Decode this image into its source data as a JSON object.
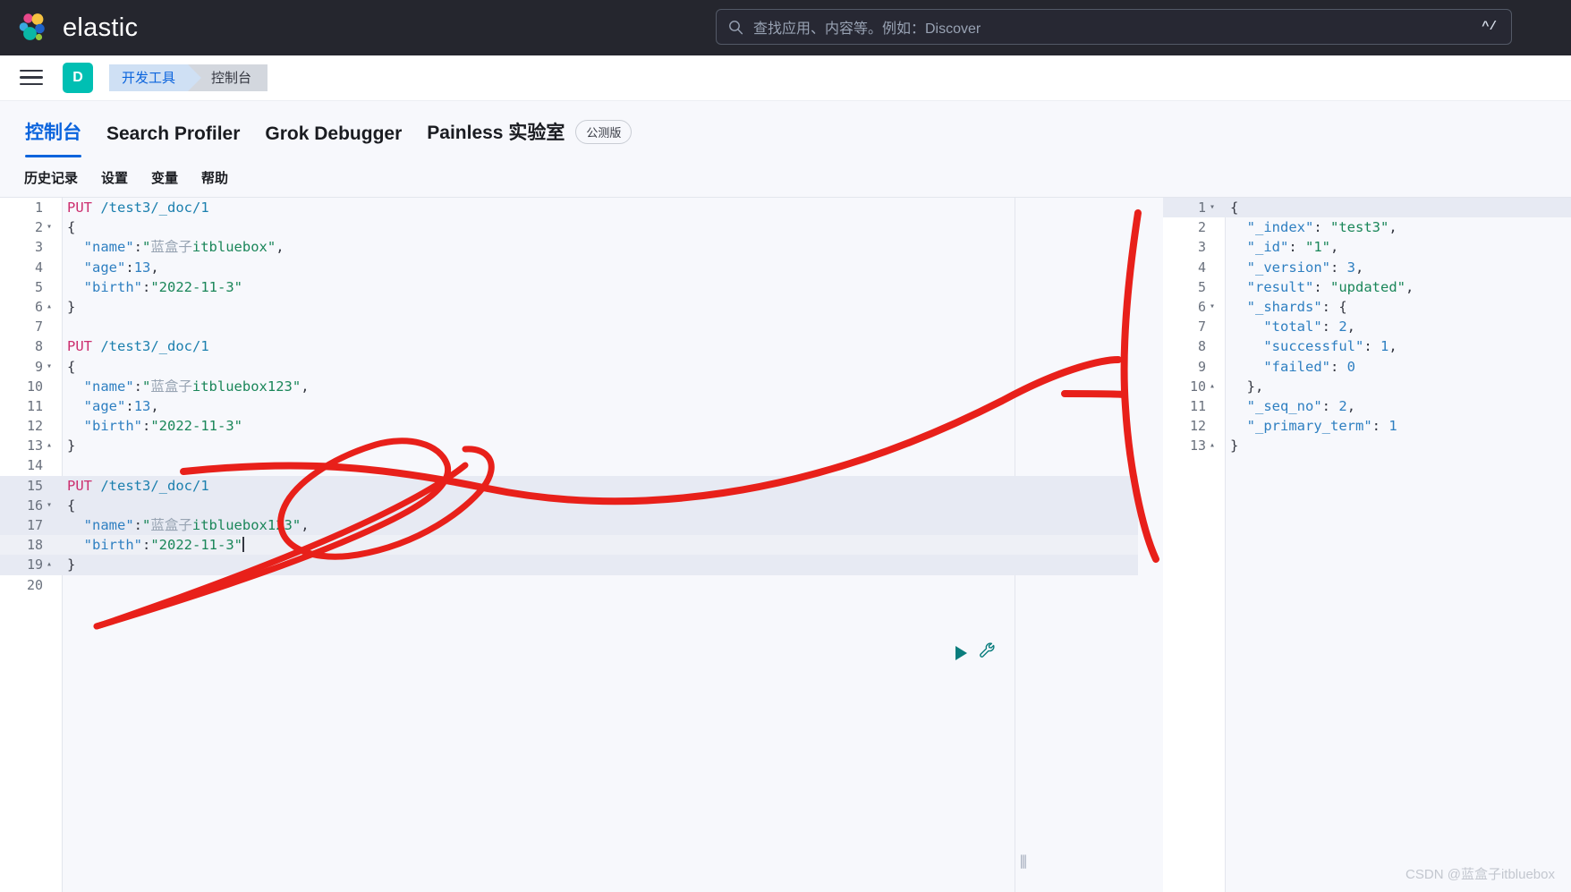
{
  "header": {
    "brand": "elastic",
    "logo_icon": "elastic-logo-icon",
    "search": {
      "icon": "search-icon",
      "placeholder": "查找应用、内容等。例如：Discover",
      "value": "",
      "shortcut": "^/"
    }
  },
  "navbar": {
    "menu_icon": "hamburger-menu-icon",
    "space_avatar": "D",
    "breadcrumbs": [
      {
        "label": "开发工具"
      },
      {
        "label": "控制台"
      }
    ]
  },
  "tabs": [
    {
      "label": "控制台",
      "active": true,
      "badge": null
    },
    {
      "label": "Search Profiler",
      "active": false,
      "badge": null
    },
    {
      "label": "Grok Debugger",
      "active": false,
      "badge": null
    },
    {
      "label": "Painless 实验室",
      "active": false,
      "badge": "公测版"
    }
  ],
  "console_menu": [
    {
      "label": "历史记录"
    },
    {
      "label": "设置"
    },
    {
      "label": "变量"
    },
    {
      "label": "帮助"
    }
  ],
  "editor": {
    "actions": {
      "play_icon": "play-run-icon",
      "wrench_icon": "wrench-tools-icon"
    },
    "drag_handle": "⫼",
    "lines": [
      {
        "n": 1,
        "fold": "",
        "hl": "",
        "segments": [
          {
            "t": "PUT",
            "c": "tok-method"
          },
          {
            "t": " ",
            "c": "tok-punc"
          },
          {
            "t": "/test3/_doc/1",
            "c": "tok-url"
          }
        ]
      },
      {
        "n": 2,
        "fold": "▾",
        "hl": "",
        "segments": [
          {
            "t": "{",
            "c": "tok-brace"
          }
        ]
      },
      {
        "n": 3,
        "fold": "",
        "hl": "",
        "segments": [
          {
            "t": "  ",
            "c": "tok-punc"
          },
          {
            "t": "\"name\"",
            "c": "tok-key"
          },
          {
            "t": ":",
            "c": "tok-punc"
          },
          {
            "t": "\"",
            "c": "tok-str"
          },
          {
            "t": "蓝盒子",
            "c": "tok-cjk"
          },
          {
            "t": "itbluebox\"",
            "c": "tok-str"
          },
          {
            "t": ",",
            "c": "tok-punc"
          }
        ]
      },
      {
        "n": 4,
        "fold": "",
        "hl": "",
        "segments": [
          {
            "t": "  ",
            "c": "tok-punc"
          },
          {
            "t": "\"age\"",
            "c": "tok-key"
          },
          {
            "t": ":",
            "c": "tok-punc"
          },
          {
            "t": "13",
            "c": "tok-num"
          },
          {
            "t": ",",
            "c": "tok-punc"
          }
        ]
      },
      {
        "n": 5,
        "fold": "",
        "hl": "",
        "segments": [
          {
            "t": "  ",
            "c": "tok-punc"
          },
          {
            "t": "\"birth\"",
            "c": "tok-key"
          },
          {
            "t": ":",
            "c": "tok-punc"
          },
          {
            "t": "\"2022-11-3\"",
            "c": "tok-str"
          }
        ]
      },
      {
        "n": 6,
        "fold": "▴",
        "hl": "",
        "segments": [
          {
            "t": "}",
            "c": "tok-brace"
          }
        ]
      },
      {
        "n": 7,
        "fold": "",
        "hl": "",
        "segments": [
          {
            "t": "",
            "c": "tok-punc"
          }
        ]
      },
      {
        "n": 8,
        "fold": "",
        "hl": "",
        "segments": [
          {
            "t": "PUT",
            "c": "tok-method"
          },
          {
            "t": " ",
            "c": "tok-punc"
          },
          {
            "t": "/test3/_doc/1",
            "c": "tok-url"
          }
        ]
      },
      {
        "n": 9,
        "fold": "▾",
        "hl": "",
        "segments": [
          {
            "t": "{",
            "c": "tok-brace"
          }
        ]
      },
      {
        "n": 10,
        "fold": "",
        "hl": "",
        "segments": [
          {
            "t": "  ",
            "c": "tok-punc"
          },
          {
            "t": "\"name\"",
            "c": "tok-key"
          },
          {
            "t": ":",
            "c": "tok-punc"
          },
          {
            "t": "\"",
            "c": "tok-str"
          },
          {
            "t": "蓝盒子",
            "c": "tok-cjk"
          },
          {
            "t": "itbluebox123\"",
            "c": "tok-str"
          },
          {
            "t": ",",
            "c": "tok-punc"
          }
        ]
      },
      {
        "n": 11,
        "fold": "",
        "hl": "",
        "segments": [
          {
            "t": "  ",
            "c": "tok-punc"
          },
          {
            "t": "\"age\"",
            "c": "tok-key"
          },
          {
            "t": ":",
            "c": "tok-punc"
          },
          {
            "t": "13",
            "c": "tok-num"
          },
          {
            "t": ",",
            "c": "tok-punc"
          }
        ]
      },
      {
        "n": 12,
        "fold": "",
        "hl": "",
        "segments": [
          {
            "t": "  ",
            "c": "tok-punc"
          },
          {
            "t": "\"birth\"",
            "c": "tok-key"
          },
          {
            "t": ":",
            "c": "tok-punc"
          },
          {
            "t": "\"2022-11-3\"",
            "c": "tok-str"
          }
        ]
      },
      {
        "n": 13,
        "fold": "▴",
        "hl": "",
        "segments": [
          {
            "t": "}",
            "c": "tok-brace"
          }
        ]
      },
      {
        "n": 14,
        "fold": "",
        "hl": "",
        "segments": [
          {
            "t": "",
            "c": "tok-punc"
          }
        ]
      },
      {
        "n": 15,
        "fold": "",
        "hl": "hl",
        "segments": [
          {
            "t": "PUT",
            "c": "tok-method"
          },
          {
            "t": " ",
            "c": "tok-punc"
          },
          {
            "t": "/test3/_doc/1",
            "c": "tok-url"
          }
        ]
      },
      {
        "n": 16,
        "fold": "▾",
        "hl": "hl",
        "segments": [
          {
            "t": "{",
            "c": "tok-brace"
          }
        ]
      },
      {
        "n": 17,
        "fold": "",
        "hl": "hl",
        "segments": [
          {
            "t": "  ",
            "c": "tok-punc"
          },
          {
            "t": "\"name\"",
            "c": "tok-key"
          },
          {
            "t": ":",
            "c": "tok-punc"
          },
          {
            "t": "\"",
            "c": "tok-str"
          },
          {
            "t": "蓝盒子",
            "c": "tok-cjk"
          },
          {
            "t": "itbluebox123\"",
            "c": "tok-str"
          },
          {
            "t": ",",
            "c": "tok-punc"
          }
        ]
      },
      {
        "n": 18,
        "fold": "",
        "hl": "hl-sub",
        "segments": [
          {
            "t": "  ",
            "c": "tok-punc"
          },
          {
            "t": "\"birth\"",
            "c": "tok-key"
          },
          {
            "t": ":",
            "c": "tok-punc"
          },
          {
            "t": "\"2022-11-3\"",
            "c": "tok-str"
          }
        ],
        "caret": true
      },
      {
        "n": 19,
        "fold": "▴",
        "hl": "hl",
        "segments": [
          {
            "t": "}",
            "c": "tok-brace"
          }
        ]
      },
      {
        "n": 20,
        "fold": "",
        "hl": "",
        "segments": [
          {
            "t": "",
            "c": "tok-punc"
          }
        ]
      }
    ]
  },
  "response": {
    "lines": [
      {
        "n": 1,
        "fold": "▾",
        "hl": "hl",
        "segments": [
          {
            "t": "{",
            "c": "tok-brace"
          }
        ]
      },
      {
        "n": 2,
        "fold": "",
        "hl": "",
        "segments": [
          {
            "t": "  ",
            "c": "tok-punc"
          },
          {
            "t": "\"_index\"",
            "c": "tok-key"
          },
          {
            "t": ": ",
            "c": "tok-punc"
          },
          {
            "t": "\"test3\"",
            "c": "tok-str"
          },
          {
            "t": ",",
            "c": "tok-punc"
          }
        ]
      },
      {
        "n": 3,
        "fold": "",
        "hl": "",
        "segments": [
          {
            "t": "  ",
            "c": "tok-punc"
          },
          {
            "t": "\"_id\"",
            "c": "tok-key"
          },
          {
            "t": ": ",
            "c": "tok-punc"
          },
          {
            "t": "\"1\"",
            "c": "tok-str"
          },
          {
            "t": ",",
            "c": "tok-punc"
          }
        ]
      },
      {
        "n": 4,
        "fold": "",
        "hl": "",
        "segments": [
          {
            "t": "  ",
            "c": "tok-punc"
          },
          {
            "t": "\"_version\"",
            "c": "tok-key"
          },
          {
            "t": ": ",
            "c": "tok-punc"
          },
          {
            "t": "3",
            "c": "tok-num"
          },
          {
            "t": ",",
            "c": "tok-punc"
          }
        ]
      },
      {
        "n": 5,
        "fold": "",
        "hl": "",
        "segments": [
          {
            "t": "  ",
            "c": "tok-punc"
          },
          {
            "t": "\"result\"",
            "c": "tok-key"
          },
          {
            "t": ": ",
            "c": "tok-punc"
          },
          {
            "t": "\"updated\"",
            "c": "tok-str"
          },
          {
            "t": ",",
            "c": "tok-punc"
          }
        ]
      },
      {
        "n": 6,
        "fold": "▾",
        "hl": "",
        "segments": [
          {
            "t": "  ",
            "c": "tok-punc"
          },
          {
            "t": "\"_shards\"",
            "c": "tok-key"
          },
          {
            "t": ": ",
            "c": "tok-punc"
          },
          {
            "t": "{",
            "c": "tok-brace"
          }
        ]
      },
      {
        "n": 7,
        "fold": "",
        "hl": "",
        "segments": [
          {
            "t": "    ",
            "c": "tok-punc"
          },
          {
            "t": "\"total\"",
            "c": "tok-key"
          },
          {
            "t": ": ",
            "c": "tok-punc"
          },
          {
            "t": "2",
            "c": "tok-num"
          },
          {
            "t": ",",
            "c": "tok-punc"
          }
        ]
      },
      {
        "n": 8,
        "fold": "",
        "hl": "",
        "segments": [
          {
            "t": "    ",
            "c": "tok-punc"
          },
          {
            "t": "\"successful\"",
            "c": "tok-key"
          },
          {
            "t": ": ",
            "c": "tok-punc"
          },
          {
            "t": "1",
            "c": "tok-num"
          },
          {
            "t": ",",
            "c": "tok-punc"
          }
        ]
      },
      {
        "n": 9,
        "fold": "",
        "hl": "",
        "segments": [
          {
            "t": "    ",
            "c": "tok-punc"
          },
          {
            "t": "\"failed\"",
            "c": "tok-key"
          },
          {
            "t": ": ",
            "c": "tok-punc"
          },
          {
            "t": "0",
            "c": "tok-num"
          }
        ]
      },
      {
        "n": 10,
        "fold": "▴",
        "hl": "",
        "segments": [
          {
            "t": "  ",
            "c": "tok-punc"
          },
          {
            "t": "}",
            "c": "tok-brace"
          },
          {
            "t": ",",
            "c": "tok-punc"
          }
        ]
      },
      {
        "n": 11,
        "fold": "",
        "hl": "",
        "segments": [
          {
            "t": "  ",
            "c": "tok-punc"
          },
          {
            "t": "\"_seq_no\"",
            "c": "tok-key"
          },
          {
            "t": ": ",
            "c": "tok-punc"
          },
          {
            "t": "2",
            "c": "tok-num"
          },
          {
            "t": ",",
            "c": "tok-punc"
          }
        ]
      },
      {
        "n": 12,
        "fold": "",
        "hl": "",
        "segments": [
          {
            "t": "  ",
            "c": "tok-punc"
          },
          {
            "t": "\"_primary_term\"",
            "c": "tok-key"
          },
          {
            "t": ": ",
            "c": "tok-punc"
          },
          {
            "t": "1",
            "c": "tok-num"
          }
        ]
      },
      {
        "n": 13,
        "fold": "▴",
        "hl": "",
        "segments": [
          {
            "t": "}",
            "c": "tok-brace"
          }
        ]
      }
    ]
  },
  "annotation": {
    "color": "#e8201a",
    "description": "hand-drawn red circle-and-arrow highlighting request block and response panel"
  },
  "watermark": "CSDN @蓝盒子itbluebox",
  "colors": {
    "header_bg": "#25262e",
    "accent_blue": "#0b64dd",
    "space_teal": "#00bfb3",
    "canvas_bg": "#f7f8fc",
    "annotation_red": "#e8201a"
  }
}
